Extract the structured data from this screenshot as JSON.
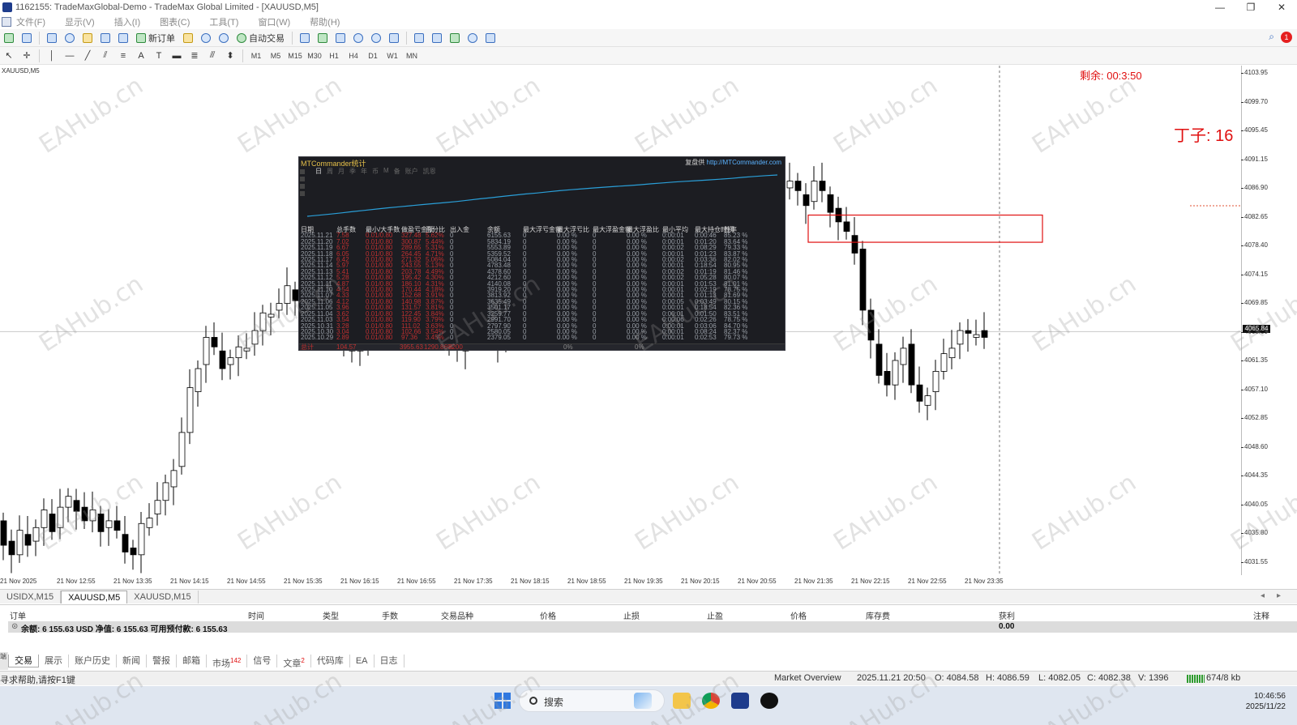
{
  "window": {
    "title": "1162155: TradeMaxGlobal-Demo - TradeMax Global Limited - [XAUUSD,M5]",
    "controls": [
      "—",
      "❐",
      "✕"
    ]
  },
  "menu": [
    "文件(F)",
    "显示(V)",
    "插入(I)",
    "图表(C)",
    "工具(T)",
    "窗口(W)",
    "帮助(H)"
  ],
  "toolbar": {
    "new_order": "新订单",
    "auto_trade": "自动交易",
    "timeframes": [
      "M1",
      "M5",
      "M15",
      "M30",
      "H1",
      "H4",
      "D1",
      "W1",
      "MN"
    ],
    "notification_count": "1"
  },
  "chart": {
    "symbol_label": "XAUUSD,M5",
    "countdown": "剩余: 00:3:50",
    "dingzi_label": "丁子: 16",
    "current_price": "4065.84",
    "price_ticks": [
      "4103.95",
      "4099.70",
      "4095.45",
      "4091.15",
      "4086.90",
      "4082.65",
      "4078.40",
      "4074.15",
      "4069.85",
      "4065.60",
      "4061.35",
      "4057.10",
      "4052.85",
      "4048.60",
      "4044.35",
      "4040.05",
      "4035.80",
      "4031.55"
    ],
    "time_ticks": [
      "21 Nov 2025",
      "21 Nov 12:55",
      "21 Nov 13:35",
      "21 Nov 14:15",
      "21 Nov 14:55",
      "21 Nov 15:35",
      "21 Nov 16:15",
      "21 Nov 16:55",
      "21 Nov 17:35",
      "21 Nov 18:15",
      "21 Nov 18:55",
      "21 Nov 19:35",
      "21 Nov 20:15",
      "21 Nov 20:55",
      "21 Nov 21:35",
      "21 Nov 22:15",
      "21 Nov 22:55",
      "21 Nov 23:35"
    ],
    "watermark": "EAHub.cn",
    "colors": {
      "up": "#ffffff",
      "down": "#000000",
      "outline": "#000000",
      "highlight_box": "#e01010"
    }
  },
  "mtc": {
    "title": "MTCommander统计",
    "credit_label": "复盘供",
    "credit_url": "http://MTCommander.com",
    "tabs": [
      "日",
      "周",
      "月",
      "季",
      "年",
      "币",
      "M",
      "备",
      "账户",
      "凯恩"
    ],
    "headers": [
      "日期",
      "总手数",
      "最小/大手数",
      "做盈亏金额",
      "百分比",
      "出入金",
      "余额",
      "最大浮亏金额",
      "最大浮亏比",
      "最大浮盈金额",
      "最大浮盈比",
      "最小平均",
      "最大持仓时间",
      "胜率"
    ],
    "rows": [
      [
        "2025.11.21",
        "7.58",
        "0.01/0.80",
        "327.48",
        "5.62%",
        "0",
        "6155.63",
        "0",
        "0.00 %",
        "0",
        "0.00 %",
        "0:00:01",
        "0:00:46",
        "85.23 %"
      ],
      [
        "2025.11.20",
        "7.02",
        "0.01/0.80",
        "300.87",
        "5.44%",
        "0",
        "5834.19",
        "0",
        "0.00 %",
        "0",
        "0.00 %",
        "0:00:01",
        "0:01:20",
        "83.64 %"
      ],
      [
        "2025.11.19",
        "6.67",
        "0.01/0.80",
        "289.65",
        "5.31%",
        "0",
        "5553.89",
        "0",
        "0.00 %",
        "0",
        "0.00 %",
        "0:00:02",
        "0:08:29",
        "79.33 %"
      ],
      [
        "2025.11.18",
        "6.05",
        "0.01/0.80",
        "264.45",
        "4.71%",
        "0",
        "5359.52",
        "0",
        "0.00 %",
        "0",
        "0.00 %",
        "0:00:01",
        "0:01:23",
        "83.87 %"
      ],
      [
        "2025.11.17",
        "6.42",
        "0.01/0.80",
        "271.32",
        "5.06%",
        "0",
        "5084.04",
        "0",
        "0.00 %",
        "0",
        "0.00 %",
        "0:00:02",
        "0:03:36",
        "82.02 %"
      ],
      [
        "2025.11.14",
        "5.97",
        "0.01/0.80",
        "243.55",
        "5.13%",
        "0",
        "4783.48",
        "0",
        "0.00 %",
        "0",
        "0.00 %",
        "0:00:01",
        "0:18:54",
        "80.95 %"
      ],
      [
        "2025.11.13",
        "5.41",
        "0.01/0.80",
        "203.78",
        "4.49%",
        "0",
        "4378.60",
        "0",
        "0.00 %",
        "0",
        "0.00 %",
        "0:00:02",
        "0:01:19",
        "81.46 %"
      ],
      [
        "2025.11.12",
        "5.28",
        "0.01/0.80",
        "195.42",
        "4.30%",
        "0",
        "4212.60",
        "0",
        "0.00 %",
        "0",
        "0.00 %",
        "0:00:02",
        "0:05:28",
        "80.07 %"
      ],
      [
        "2025.11.11",
        "4.87",
        "0.01/0.80",
        "186.10",
        "4.31%",
        "0",
        "4140.08",
        "0",
        "0.00 %",
        "0",
        "0.00 %",
        "0:00:01",
        "0:01:53",
        "81.01 %"
      ],
      [
        "2025.11.10",
        "4.54",
        "0.01/0.80",
        "170.44",
        "4.18%",
        "0",
        "3919.20",
        "0",
        "0.00 %",
        "0",
        "0.00 %",
        "0:00:01",
        "0:02:19",
        "78.75 %"
      ],
      [
        "2025.11.07",
        "4.33",
        "0.01/0.80",
        "152.68",
        "3.91%",
        "0",
        "3813.92",
        "0",
        "0.00 %",
        "0",
        "0.00 %",
        "0:00:01",
        "0:01:13",
        "81.69 %"
      ],
      [
        "2025.11.06",
        "4.12",
        "0.01/0.80",
        "140.98",
        "3.87%",
        "0",
        "3635.49",
        "0",
        "0.00 %",
        "0",
        "0.00 %",
        "0:00:05",
        "0:03:49",
        "80.15 %"
      ],
      [
        "2025.11.05",
        "3.96",
        "0.01/0.80",
        "131.57",
        "3.81%",
        "0",
        "3501.17",
        "0",
        "0.00 %",
        "0",
        "0.00 %",
        "0:00:01",
        "0:18:54",
        "82.36 %"
      ],
      [
        "2025.11.04",
        "3.62",
        "0.01/0.80",
        "122.45",
        "3.84%",
        "0",
        "3259.77",
        "0",
        "0.00 %",
        "0",
        "0.00 %",
        "0:00:01",
        "0:01:50",
        "83.51 %"
      ],
      [
        "2025.11.03",
        "3.54",
        "0.01/0.80",
        "119.90",
        "3.79%",
        "0",
        "2991.70",
        "0",
        "0.00 %",
        "0",
        "0.00 %",
        "0:00:06",
        "0:02:26",
        "78.75 %"
      ],
      [
        "2025.10.31",
        "3.28",
        "0.01/0.80",
        "111.02",
        "3.63%",
        "0",
        "2797.90",
        "0",
        "0.00 %",
        "0",
        "0.00 %",
        "0:00:01",
        "0:03:06",
        "84.70 %"
      ],
      [
        "2025.10.30",
        "3.04",
        "0.01/0.80",
        "102.66",
        "3.54%",
        "0",
        "2580.05",
        "0",
        "0.00 %",
        "0",
        "0.00 %",
        "0:00:01",
        "0:08:24",
        "82.37 %"
      ],
      [
        "2025.10.29",
        "2.89",
        "0.01/0.80",
        "97.36",
        "3.45%",
        "0",
        "2379.05",
        "0",
        "0.00 %",
        "0",
        "0.00 %",
        "0:00:01",
        "0:02:53",
        "79.73 %"
      ]
    ],
    "footer": [
      "总计",
      "104.57",
      "",
      "3955.63",
      "1290.86%",
      "3200"
    ],
    "footer_extra": [
      "0%",
      "0%"
    ],
    "equity_curve": [
      1,
      2.2,
      3.6,
      5,
      6.6,
      8,
      9.5,
      11,
      12.2,
      13.5,
      14.8,
      16,
      17.2,
      18.5,
      20,
      21.6,
      23,
      24.5,
      26,
      27.4,
      28.6,
      30,
      31.3,
      32.5,
      33.6,
      34.6,
      35.6,
      36.5,
      37.4,
      38.4,
      39.5,
      40.6,
      41.6,
      42.5,
      43.3,
      44.1,
      45,
      46,
      47.2,
      48.3,
      49.2,
      50
    ]
  },
  "chart_tabs": [
    "USIDX,M15",
    "XAUUSD,M5",
    "XAUUSD,M15"
  ],
  "terminal": {
    "headers": [
      "订单",
      "时间",
      "类型",
      "手数",
      "交易品种",
      "价格",
      "止损",
      "止盈",
      "价格",
      "库存费",
      "获利",
      "注释"
    ],
    "balance_label": "余额: 6 155.63 USD  净值: 6 155.63  可用预付款: 6 155.63",
    "profit": "0.00",
    "side_label": "端",
    "tabs": [
      {
        "label": "交易",
        "badge": ""
      },
      {
        "label": "展示",
        "badge": ""
      },
      {
        "label": "账户历史",
        "badge": ""
      },
      {
        "label": "新闻",
        "badge": ""
      },
      {
        "label": "警报",
        "badge": ""
      },
      {
        "label": "邮箱",
        "badge": ""
      },
      {
        "label": "市场",
        "badge": "142"
      },
      {
        "label": "信号",
        "badge": ""
      },
      {
        "label": "文章",
        "badge": "2"
      },
      {
        "label": "代码库",
        "badge": ""
      },
      {
        "label": "EA",
        "badge": ""
      },
      {
        "label": "日志",
        "badge": ""
      }
    ]
  },
  "status": {
    "help": "寻求帮助,请按F1键",
    "overview": "Market Overview",
    "datetime": "2025.11.21 20:50",
    "open": "O: 4084.58",
    "high": "H: 4086.59",
    "low": "L: 4082.05",
    "close": "C: 4082.38",
    "volume": "V: 1396",
    "traffic": "674/8 kb"
  },
  "taskbar": {
    "search_placeholder": "搜索",
    "time": "10:46:56",
    "date": "2025/11/22"
  }
}
